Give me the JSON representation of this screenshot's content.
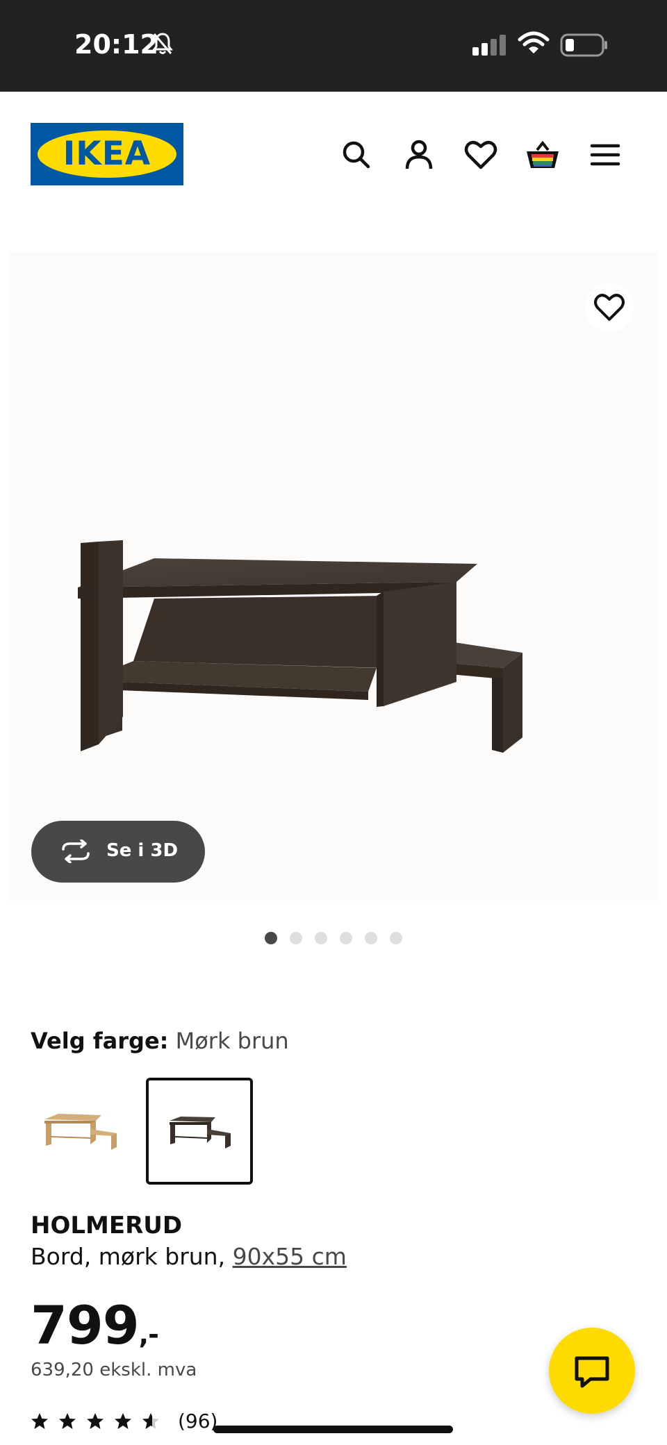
{
  "status_bar": {
    "time": "20:12"
  },
  "header": {
    "logo_text": "IKEA"
  },
  "gallery": {
    "see_3d_label": "Se i 3D",
    "image_count": 6,
    "active_image_index": 0
  },
  "color_picker": {
    "label": "Velg farge:",
    "selected_value": "Mørk brun"
  },
  "product": {
    "name": "HOLMERUD",
    "description": "Bord, mørk brun, ",
    "size_link": "90x55 cm",
    "price": "799",
    "price_suffix": ",-",
    "price_ex_vat": "639,20 ekskl. mva",
    "rating": 4.5,
    "rating_count": "(96)"
  },
  "colors": {
    "brand_blue": "#0058a3",
    "brand_yellow": "#ffdb00",
    "dark_gray": "#484848"
  }
}
